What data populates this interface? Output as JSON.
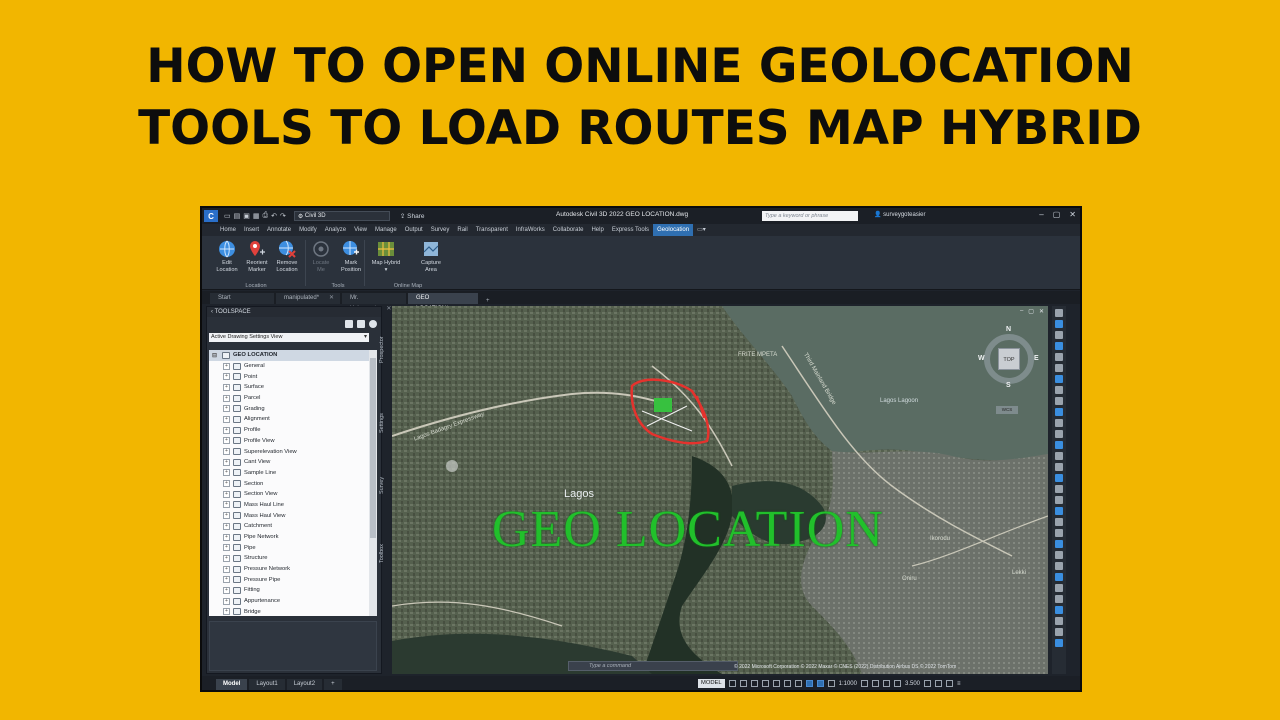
{
  "headline": {
    "line1": "HOW TO OPEN ONLINE GEOLOCATION",
    "line2": "TOOLS TO LOAD ROUTES MAP HYBRID"
  },
  "titlebar": {
    "logo": "C",
    "workspace": "Civil 3D",
    "share": "Share",
    "app_title": "Autodesk Civil 3D 2022   GEO LOCATION.dwg",
    "search_placeholder": "Type a keyword or phrase",
    "user": "surveygoteasier"
  },
  "ribbon_tabs": [
    "Home",
    "Insert",
    "Annotate",
    "Modify",
    "Analyze",
    "View",
    "Manage",
    "Output",
    "Survey",
    "Rail",
    "Transparent",
    "InfraWorks",
    "Collaborate",
    "Help",
    "Express Tools",
    "Geolocation"
  ],
  "ribbon_active_tab": "Geolocation",
  "ribbon": {
    "location": {
      "label": "Location",
      "buttons": [
        {
          "label1": "Edit",
          "label2": "Location",
          "icon": "globe-icon"
        },
        {
          "label1": "Reorient",
          "label2": "Marker",
          "icon": "pin-icon"
        },
        {
          "label1": "Remove",
          "label2": "Location",
          "icon": "globe-remove-icon"
        }
      ]
    },
    "tools": {
      "label": "Tools",
      "buttons": [
        {
          "label1": "Locate",
          "label2": "Me",
          "icon": "locate-icon"
        },
        {
          "label1": "Mark",
          "label2": "Position",
          "icon": "mark-position-icon"
        }
      ]
    },
    "online_map": {
      "label": "Online Map",
      "buttons": [
        {
          "label1": "Map Hybrid",
          "label2": "",
          "icon": "map-hybrid-icon"
        },
        {
          "label1": "Capture",
          "label2": "Area",
          "icon": "capture-area-icon"
        }
      ]
    }
  },
  "doc_tabs": [
    {
      "label": "Start",
      "closable": false
    },
    {
      "label": "manipulated*",
      "closable": true
    },
    {
      "label": "Mr. Uchenna*",
      "closable": true
    },
    {
      "label": "GEO LOCATION*",
      "closable": true,
      "active": true
    }
  ],
  "toolspace": {
    "title": "TOOLSPACE",
    "view": "Active Drawing Settings View",
    "root": "GEO LOCATION",
    "items": [
      "General",
      "Point",
      "Surface",
      "Parcel",
      "Grading",
      "Alignment",
      "Profile",
      "Profile View",
      "Superelevation View",
      "Cant View",
      "Sample Line",
      "Section",
      "Section View",
      "Mass Haul Line",
      "Mass Haul View",
      "Catchment",
      "Pipe Network",
      "Pipe",
      "Structure",
      "Pressure Network",
      "Pressure Pipe",
      "Fitting",
      "Appurtenance",
      "Bridge"
    ],
    "side_tabs": [
      "Prospector",
      "Settings",
      "Survey",
      "Toolbox"
    ]
  },
  "map": {
    "watermark": "GEO LOCATION",
    "city_label": "Lagos",
    "lagoon_label": "Lagos Lagoon",
    "place_labels": [
      "Lagos Badagry Expressway",
      "FRITE MPETA",
      "Third Mainland Bridge",
      "Ikorodu",
      "Oniru",
      "Lekki"
    ],
    "viewcube": {
      "top": "TOP",
      "n": "N",
      "s": "S",
      "e": "E",
      "w": "W",
      "wcs": "WCS"
    },
    "copyright": "© 2022 Microsoft Corporation © 2022 Maxar © CNES (2022) Distribution Airbus DS © 2022 TomTom",
    "command_placeholder": "Type a command"
  },
  "statusbar": {
    "layouts": [
      "Model",
      "Layout1",
      "Layout2"
    ],
    "model_btn": "MODEL",
    "scale": "1:1000",
    "value": "3.500"
  },
  "colors": {
    "background": "#f2b600",
    "accent": "#2f6fb1",
    "watermark": "#21c02b"
  }
}
